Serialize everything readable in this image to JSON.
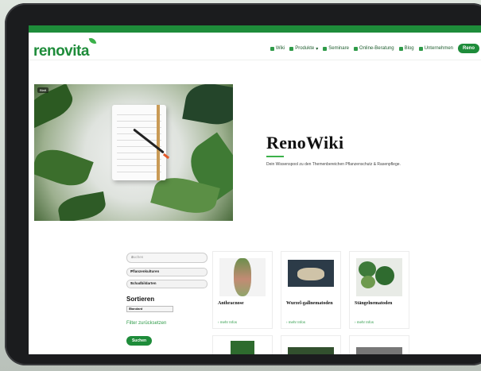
{
  "brand": {
    "logo_text": "renovita",
    "accent": "#1e8c3a"
  },
  "nav": {
    "items": [
      {
        "label": "Wiki",
        "icon": "book-icon"
      },
      {
        "label": "Produkte",
        "icon": "leaf-icon",
        "dropdown": true
      },
      {
        "label": "Seminare",
        "icon": "people-icon"
      },
      {
        "label": "Online-Beratung",
        "icon": "leaf-icon"
      },
      {
        "label": "Blog",
        "icon": "mail-icon"
      },
      {
        "label": "Unternehmen",
        "icon": "building-icon"
      }
    ],
    "cta_label": "Reno"
  },
  "hero": {
    "tag": "Blatt",
    "title": "RenoWiki",
    "subtitle": "Dein Wissenspool zu den Themenbereichen Pflanzenschutz & Rasenpflege."
  },
  "filters": {
    "search_placeholder": "Suchen",
    "select1": "Pflanzenkulturen",
    "select2": "Schadbildarten",
    "sort_heading": "Sortieren",
    "sort_value": "Standard",
    "reset_label": "Filter zurücksetzen",
    "submit_label": "Suchen"
  },
  "cards": [
    {
      "title": "Anthracnose",
      "more": "› mehr Infos"
    },
    {
      "title": "Wurzel-gallnematoden",
      "more": "› mehr Infos"
    },
    {
      "title": "Stängelnematoden",
      "more": "› mehr Infos"
    }
  ]
}
